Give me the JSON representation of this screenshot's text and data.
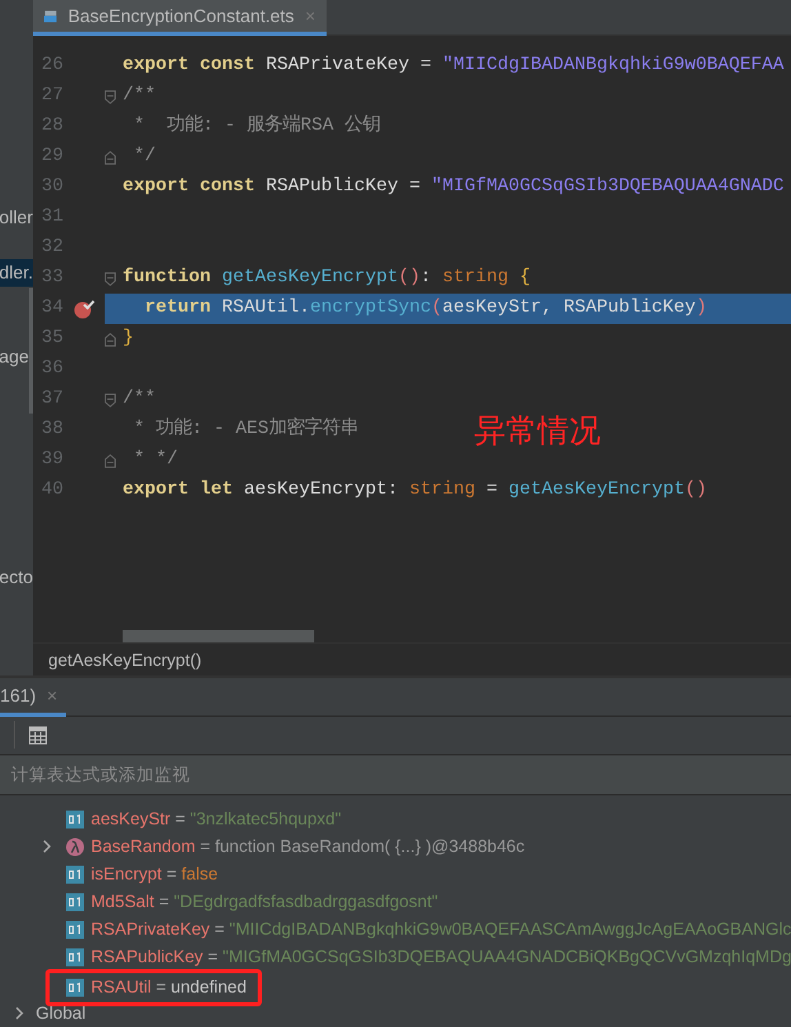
{
  "project_panel": {
    "items": [
      {
        "label": "oller",
        "selected": false
      },
      {
        "label": "dler.",
        "selected": true
      },
      {
        "label": "age",
        "selected": false
      },
      {
        "label": "ecto",
        "selected": false
      }
    ]
  },
  "editor": {
    "tab": {
      "title": "BaseEncryptionConstant.ets",
      "close": "×",
      "selected": true
    },
    "lines": [
      {
        "number": "26",
        "kind": "plain",
        "breakpoint": false,
        "current": false,
        "tokens": [
          {
            "text": "export const ",
            "kind": "keyword"
          },
          {
            "text": "RSAPrivateKey = ",
            "kind": "ident"
          },
          {
            "text": "\"MIICdgIBADANBgkqhkiG9w0BAQEFAA",
            "kind": "string"
          }
        ]
      },
      {
        "number": "27",
        "kind": "fold-start",
        "breakpoint": false,
        "current": false,
        "tokens": [
          {
            "text": "/**",
            "kind": "comment"
          }
        ]
      },
      {
        "number": "28",
        "kind": "plain",
        "breakpoint": false,
        "current": false,
        "tokens": [
          {
            "text": " *  功能: - 服务端RSA 公钥",
            "kind": "comment"
          }
        ]
      },
      {
        "number": "29",
        "kind": "fold-end",
        "breakpoint": false,
        "current": false,
        "tokens": [
          {
            "text": " */",
            "kind": "comment"
          }
        ]
      },
      {
        "number": "30",
        "kind": "plain",
        "breakpoint": false,
        "current": false,
        "tokens": [
          {
            "text": "export const ",
            "kind": "keyword"
          },
          {
            "text": "RSAPublicKey = ",
            "kind": "ident"
          },
          {
            "text": "\"MIGfMA0GCSqGSIb3DQEBAQUAA4GNADC",
            "kind": "string"
          }
        ]
      },
      {
        "number": "31",
        "kind": "plain",
        "breakpoint": false,
        "current": false
      },
      {
        "number": "32",
        "kind": "plain",
        "breakpoint": false,
        "current": false
      },
      {
        "number": "33",
        "kind": "fold-start",
        "breakpoint": false,
        "current": false,
        "tokens": [
          {
            "text": "function ",
            "kind": "keyword"
          },
          {
            "text": "getAesKeyEncrypt",
            "kind": "func"
          },
          {
            "text": "()",
            "kind": "paren"
          },
          {
            "text": ": ",
            "kind": "ident"
          },
          {
            "text": "string ",
            "kind": "type"
          },
          {
            "text": "{",
            "kind": "brace"
          }
        ]
      },
      {
        "number": "34",
        "kind": "plain",
        "breakpoint": true,
        "current": true,
        "tokens": [
          {
            "text": "  return ",
            "kind": "keyword"
          },
          {
            "text": "RSAUtil.",
            "kind": "ident"
          },
          {
            "text": "encryptSync",
            "kind": "func"
          },
          {
            "text": "(",
            "kind": "paren"
          },
          {
            "text": "aesKeyStr, RSAPublicKey",
            "kind": "ident"
          },
          {
            "text": ")",
            "kind": "paren"
          }
        ]
      },
      {
        "number": "35",
        "kind": "fold-end",
        "breakpoint": false,
        "current": false,
        "tokens": [
          {
            "text": "}",
            "kind": "brace"
          }
        ]
      },
      {
        "number": "36",
        "kind": "plain",
        "breakpoint": false,
        "current": false
      },
      {
        "number": "37",
        "kind": "fold-start",
        "breakpoint": false,
        "current": false,
        "tokens": [
          {
            "text": "/**",
            "kind": "comment"
          }
        ]
      },
      {
        "number": "38",
        "kind": "plain",
        "breakpoint": false,
        "current": false,
        "tokens": [
          {
            "text": " * 功能: - AES加密字符串",
            "kind": "comment"
          }
        ]
      },
      {
        "number": "39",
        "kind": "fold-end",
        "breakpoint": false,
        "current": false,
        "tokens": [
          {
            "text": " * */",
            "kind": "comment"
          }
        ]
      },
      {
        "number": "40",
        "kind": "plain",
        "breakpoint": false,
        "current": false,
        "tokens": [
          {
            "text": "export let ",
            "kind": "keyword"
          },
          {
            "text": "aesKeyEncrypt: ",
            "kind": "ident"
          },
          {
            "text": "string ",
            "kind": "type"
          },
          {
            "text": "= ",
            "kind": "ident"
          },
          {
            "text": "getAesKeyEncrypt",
            "kind": "func"
          },
          {
            "text": "()",
            "kind": "paren"
          }
        ]
      }
    ],
    "annotation": "异常情况",
    "breadcrumb": "getAesKeyEncrypt()"
  },
  "debugger": {
    "tab": {
      "label": "161)",
      "close": "×",
      "selected": true
    },
    "evaluate": {
      "placeholder": "计算表达式或添加监视"
    },
    "variables": [
      {
        "kind": "value",
        "name": "aesKeyStr",
        "operator": "=",
        "value": {
          "text": "\"3nzlkatec5hqupxd\"",
          "kind": "string"
        },
        "expandable": false,
        "highlighted": false
      },
      {
        "kind": "function",
        "name": "BaseRandom",
        "operator": "=",
        "value": {
          "text": "function BaseRandom( {...} )@3488b46c",
          "kind": "function"
        },
        "expandable": true,
        "highlighted": false
      },
      {
        "kind": "value",
        "name": "isEncrypt",
        "operator": "=",
        "value": {
          "text": "false",
          "kind": "boolean"
        },
        "expandable": false,
        "highlighted": false
      },
      {
        "kind": "value",
        "name": "Md5Salt",
        "operator": "=",
        "value": {
          "text": "\"DEgdrgadfsfasdbadrggasdfgosnt\"",
          "kind": "string"
        },
        "expandable": false,
        "highlighted": false
      },
      {
        "kind": "value",
        "name": "RSAPrivateKey",
        "operator": "=",
        "value": {
          "text": "\"MIICdgIBADANBgkqhkiG9w0BAQEFAASCAmAwggJcAgEAAoGBANGlc",
          "kind": "string"
        },
        "expandable": false,
        "highlighted": false
      },
      {
        "kind": "value",
        "name": "RSAPublicKey",
        "operator": "=",
        "value": {
          "text": "\"MIGfMA0GCSqGSIb3DQEBAQUAA4GNADCBiQKBgQCVvGMzqhIqMDg",
          "kind": "string"
        },
        "expandable": false,
        "highlighted": false
      },
      {
        "kind": "value",
        "name": "RSAUtil",
        "operator": "=",
        "value": {
          "text": "undefined",
          "kind": "undefined"
        },
        "expandable": false,
        "highlighted": true
      },
      {
        "kind": "group",
        "name": "Global",
        "expandable": true,
        "highlighted": false
      }
    ]
  }
}
